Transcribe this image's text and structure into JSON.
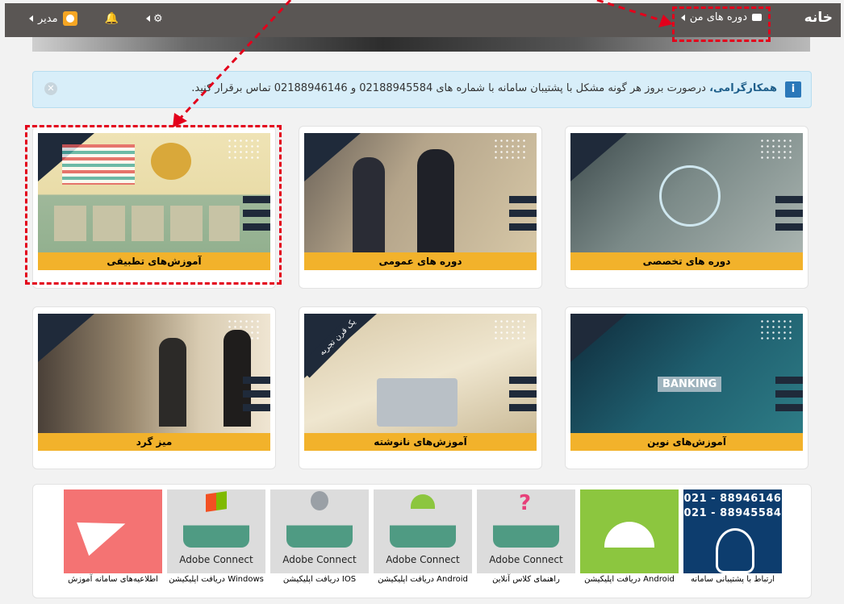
{
  "topbar": {
    "home": "خانه",
    "my_courses": "دوره های من",
    "user_name": "مدیر",
    "icons": [
      "bell-icon",
      "gear-icon",
      "briefcase-icon"
    ]
  },
  "alert": {
    "title": "همکارگرامی،",
    "text": "درصورت بروز هر گونه مشکل با پشتیبان سامانه با شماره های 02188945584 و 02188946146 تماس برقرار کنید."
  },
  "cards": [
    {
      "caption": "دوره های تخصصی",
      "name": "card-specialized-courses"
    },
    {
      "caption": "دوره های عمومی",
      "name": "card-general-courses"
    },
    {
      "caption": "آموزش‌های تطبیقی",
      "name": "card-adaptive-training"
    },
    {
      "caption": "آموزش‌های نوین",
      "name": "card-modern-training"
    },
    {
      "caption": "آموزش‌های نانوشته",
      "name": "card-unwritten-training",
      "ribbon": "یک قرن تجربه"
    },
    {
      "caption": "میز گرد",
      "name": "card-round-table"
    }
  ],
  "banking_label": "BANKING",
  "bottom": {
    "phone1": "021 - 88946146",
    "phone2": "021 - 88945584",
    "tiles": [
      {
        "label": "ارتباط با پشتیبانی سامانه"
      },
      {
        "label": "دریافت اپلیکیشن Android"
      },
      {
        "label": "راهنمای کلاس آنلاین",
        "word": "Adobe Connect"
      },
      {
        "label": "دریافت اپلیکیشن Android",
        "word": "Adobe Connect"
      },
      {
        "label": "دریافت اپلیکیشن IOS",
        "word": "Adobe Connect"
      },
      {
        "label": "دریافت اپلیکیشن Windows",
        "word": "Adobe Connect"
      },
      {
        "label": "اطلاعیه‌های سامانه آموزش"
      }
    ]
  },
  "colors": {
    "accent": "#f2b22b",
    "navy": "#1f2a3a",
    "highlight": "#e3001b",
    "topbar": "#5a5654"
  }
}
